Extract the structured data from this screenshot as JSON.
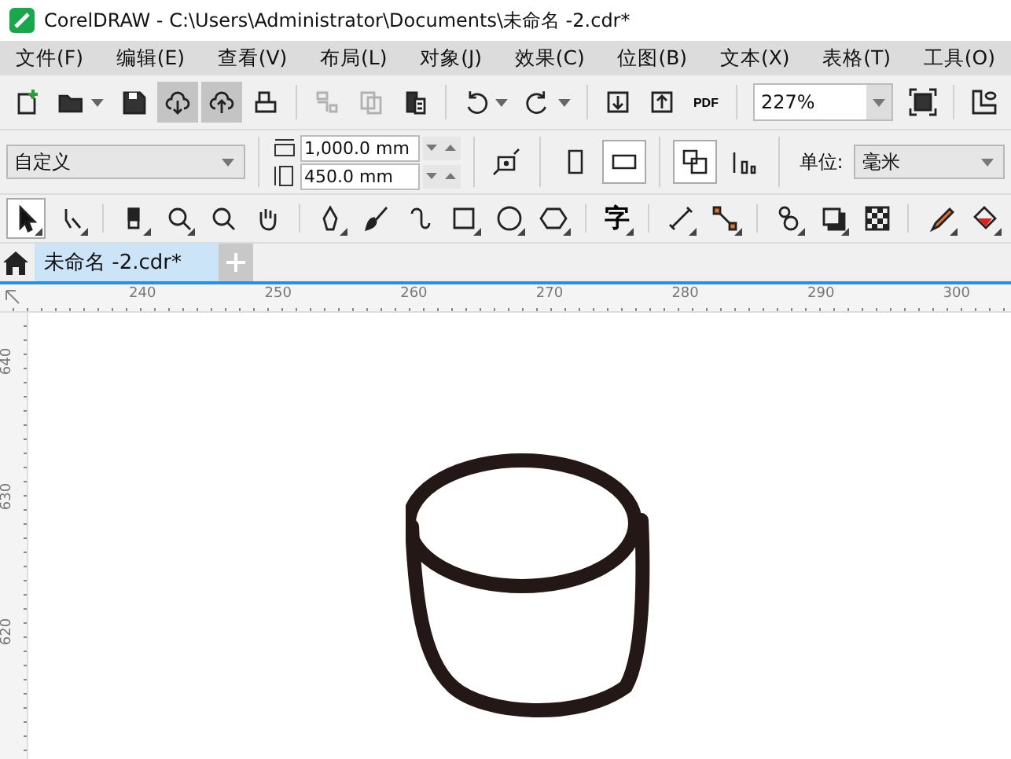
{
  "window": {
    "title": "CorelDRAW - C:\\Users\\Administrator\\Documents\\未命名 -2.cdr*"
  },
  "menu": [
    "文件(F)",
    "编辑(E)",
    "查看(V)",
    "布局(L)",
    "对象(J)",
    "效果(C)",
    "位图(B)",
    "文本(X)",
    "表格(T)",
    "工具(O)"
  ],
  "toolbar": [
    {
      "kind": "new",
      "pressed": false,
      "disabled": false,
      "dropdown": false
    },
    {
      "kind": "open",
      "pressed": false,
      "disabled": false,
      "dropdown": true
    },
    {
      "kind": "save",
      "pressed": false,
      "disabled": false,
      "dropdown": false
    },
    {
      "kind": "cloud-down",
      "pressed": true,
      "disabled": false,
      "dropdown": false
    },
    {
      "kind": "cloud-up",
      "pressed": true,
      "disabled": false,
      "dropdown": false
    },
    {
      "kind": "print",
      "pressed": false,
      "disabled": false,
      "dropdown": false
    },
    {
      "kind": "separator"
    },
    {
      "kind": "copy-props",
      "pressed": false,
      "disabled": true,
      "dropdown": false
    },
    {
      "kind": "copy",
      "pressed": false,
      "disabled": true,
      "dropdown": false
    },
    {
      "kind": "paste",
      "pressed": false,
      "disabled": false,
      "dropdown": false
    },
    {
      "kind": "separator"
    },
    {
      "kind": "undo",
      "pressed": false,
      "disabled": false,
      "dropdown": true
    },
    {
      "kind": "redo",
      "pressed": false,
      "disabled": false,
      "dropdown": true
    },
    {
      "kind": "separator"
    },
    {
      "kind": "import",
      "pressed": false,
      "disabled": false,
      "dropdown": false
    },
    {
      "kind": "export",
      "pressed": false,
      "disabled": false,
      "dropdown": false
    },
    {
      "kind": "pdf",
      "label": "PDF",
      "pressed": false,
      "disabled": false,
      "dropdown": false
    },
    {
      "kind": "separator"
    },
    {
      "kind": "zoom-field",
      "value": "227%"
    },
    {
      "kind": "fullscreen",
      "pressed": false,
      "disabled": false,
      "dropdown": false
    },
    {
      "kind": "separator"
    },
    {
      "kind": "ruler-options",
      "pressed": false,
      "disabled": false,
      "dropdown": false
    }
  ],
  "property_bar": {
    "page_size": "自定义",
    "width": "1,000.0 mm",
    "height": "450.0 mm",
    "orientation": [
      {
        "kind": "portrait",
        "selected": false
      },
      {
        "kind": "landscape",
        "selected": true
      }
    ],
    "page_options": [
      {
        "kind": "all-pages",
        "selected": true
      },
      {
        "kind": "current-page",
        "selected": false
      }
    ],
    "unit_label": "单位:",
    "unit": "毫米"
  },
  "toolbox": [
    {
      "kind": "pick",
      "pressed": true,
      "flyout": true
    },
    {
      "kind": "shape",
      "pressed": false,
      "flyout": true
    },
    {
      "kind": "separator"
    },
    {
      "kind": "eraser",
      "pressed": false,
      "flyout": true
    },
    {
      "kind": "zoom",
      "pressed": false,
      "flyout": true
    },
    {
      "kind": "zoom",
      "pressed": false,
      "flyout": false
    },
    {
      "kind": "pan",
      "pressed": false,
      "flyout": false
    },
    {
      "kind": "separator"
    },
    {
      "kind": "pen",
      "pressed": false,
      "flyout": true
    },
    {
      "kind": "brush",
      "pressed": false,
      "flyout": false
    },
    {
      "kind": "curve",
      "pressed": false,
      "flyout": false
    },
    {
      "kind": "rect",
      "pressed": false,
      "flyout": true
    },
    {
      "kind": "ellipse",
      "pressed": false,
      "flyout": true
    },
    {
      "kind": "polygon",
      "pressed": false,
      "flyout": true
    },
    {
      "kind": "separator"
    },
    {
      "kind": "text",
      "label": "字",
      "pressed": false,
      "flyout": true
    },
    {
      "kind": "separator"
    },
    {
      "kind": "dimension",
      "pressed": false,
      "flyout": true
    },
    {
      "kind": "connector",
      "pressed": false,
      "flyout": true
    },
    {
      "kind": "separator"
    },
    {
      "kind": "blend",
      "pressed": false,
      "flyout": true
    },
    {
      "kind": "shadow",
      "pressed": false,
      "flyout": true
    },
    {
      "kind": "transparency",
      "pressed": false,
      "flyout": false
    },
    {
      "kind": "separator"
    },
    {
      "kind": "eyedropper",
      "pressed": false,
      "flyout": true
    },
    {
      "kind": "fill",
      "pressed": false,
      "flyout": true
    }
  ],
  "tabs": [
    {
      "label": "未命名 -2.cdr*",
      "selected": true
    }
  ],
  "ruler": {
    "horizontal": [
      "240",
      "250",
      "260",
      "270",
      "280",
      "290",
      "300"
    ],
    "vertical": [
      "640",
      "630",
      "620"
    ]
  }
}
